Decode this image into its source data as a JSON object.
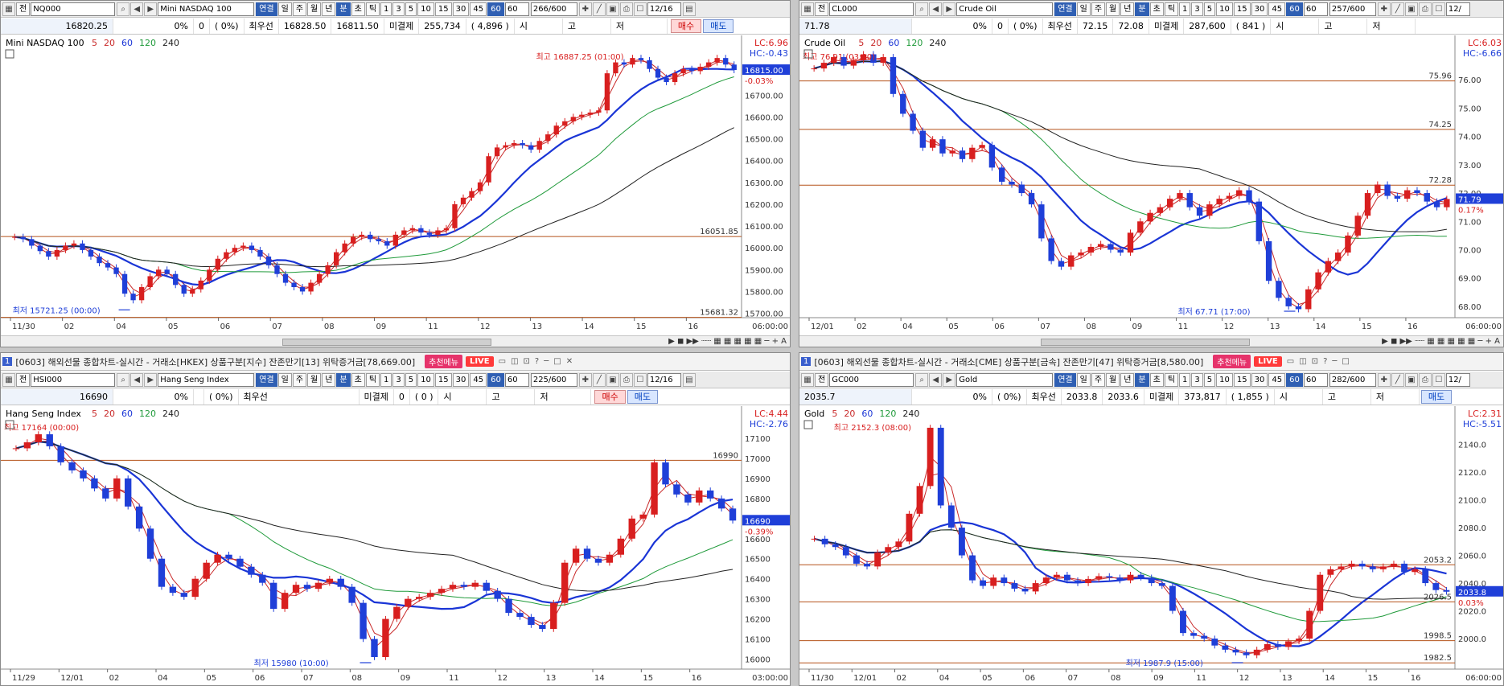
{
  "colors": {
    "up": "#d81f1f",
    "down": "#1f3fd8",
    "ma5": "#c92a2a",
    "ma20": "#c92a2a",
    "ma60": "#1a35d6",
    "ma120": "#1f9a3a",
    "ma240": "#222222",
    "hline": "#b5521a",
    "buy": "#c00000",
    "sell": "#0040c0"
  },
  "legend": {
    "ma_periods": [
      "5",
      "20",
      "60",
      "120",
      "240"
    ]
  },
  "periods": [
    "1",
    "3",
    "5",
    "10",
    "15",
    "30",
    "45",
    "60"
  ],
  "timeframes": [
    "연결",
    "일",
    "주",
    "월",
    "년",
    "분",
    "초",
    "틱"
  ],
  "panels": [
    {
      "id": "nq",
      "window_title": "",
      "code": "NQ000",
      "name": "Mini NASDAQ 100",
      "period": "60",
      "count": "266/600",
      "date": "12/16",
      "price": "16820.25",
      "change": "0",
      "pct": "0%",
      "pct_paren": "(      0%)",
      "best_label": "최우선",
      "best_bid": "16828.50",
      "best_ask": "16811.50",
      "oi_label": "미결제",
      "oi": "255,734",
      "oi_chg": "( 4,896 )",
      "o_label": "시",
      "h_label": "고",
      "l_label": "저",
      "buy": "매수",
      "sell": "매도",
      "chart_title": "Mini NASDAQ 100",
      "lc": "LC:6.96",
      "hc": "HC:-0.43",
      "cur_tag": "16815.00",
      "cur_pct": "-0.03%",
      "high_note": "최고 16887.25 (01:00)",
      "low_note": "최저 15721.25 (00:00)",
      "hlines": [
        {
          "v": 16051.85,
          "label": "16051.85"
        },
        {
          "v": 15681.32,
          "label": "15681.32"
        }
      ],
      "yticks": [
        "16700.00",
        "16600.00",
        "16500.00",
        "16400.00",
        "16300.00",
        "16200.00",
        "16100.00",
        "16000.00",
        "15900.00",
        "15800.00",
        "15700.00"
      ],
      "xticks": [
        "11/30",
        "02",
        "04",
        "05",
        "06",
        "07",
        "08",
        "09",
        "11",
        "12",
        "13",
        "14",
        "15",
        "16"
      ],
      "x_end": "06:00:00"
    },
    {
      "id": "cl",
      "window_title": "",
      "code": "CL000",
      "name": "Crude Oil",
      "period": "60",
      "count": "257/600",
      "date": "12/",
      "price": "71.78",
      "change": "0",
      "pct": "0%",
      "pct_paren": "(      0%)",
      "best_label": "최우선",
      "best_bid": "72.15",
      "best_ask": "72.08",
      "oi_label": "미결제",
      "oi": "287,600",
      "oi_chg": "(   841 )",
      "o_label": "시",
      "h_label": "고",
      "l_label": "저",
      "buy": "",
      "sell": "",
      "chart_title": "Crude Oil",
      "lc": "LC:6.03",
      "hc": "HC:-6.66",
      "cur_tag": "71.79",
      "cur_pct": "0.17%",
      "high_note": "최고 76.91 (03:00)",
      "low_note": "최저 67.71 (17:00)",
      "hlines": [
        {
          "v": 75.96,
          "label": "75.96"
        },
        {
          "v": 74.25,
          "label": "74.25"
        },
        {
          "v": 72.28,
          "label": "72.28"
        }
      ],
      "yticks": [
        "76.00",
        "75.00",
        "74.00",
        "73.00",
        "72.00",
        "71.00",
        "70.00",
        "69.00",
        "68.00"
      ],
      "xticks": [
        "12/01",
        "02",
        "04",
        "05",
        "06",
        "07",
        "08",
        "09",
        "11",
        "12",
        "13",
        "14",
        "15",
        "16"
      ],
      "x_end": "06:00:00"
    },
    {
      "id": "hsi",
      "window_title": "[0603] 해외선물 종합차트-실시간 - 거래소[HKEX] 상품구분[지수] 잔존만기[13] 위탁증거금[78,669.00]",
      "code": "HSI000",
      "name": "Hang Seng Index",
      "period": "60",
      "count": "225/600",
      "date": "12/16",
      "price": "16690",
      "change": "",
      "pct": "0%",
      "pct_paren": "(      0%)",
      "best_label": "최우선",
      "best_bid": "",
      "best_ask": "",
      "oi_label": "미결제",
      "oi": "0",
      "oi_chg": "(    0 )",
      "o_label": "시",
      "h_label": "고",
      "l_label": "저",
      "buy": "매수",
      "sell": "매도",
      "chart_title": "Hang Seng Index",
      "lc": "LC:4.44",
      "hc": "HC:-2.76",
      "cur_tag": "16690",
      "cur_pct": "-0.39%",
      "high_note": "최고 17164 (00:00)",
      "low_note": "최저 15980 (10:00)",
      "hlines": [
        {
          "v": 16990,
          "label": "16990"
        }
      ],
      "yticks": [
        "17100",
        "17000",
        "16900",
        "16800",
        "16700",
        "16600",
        "16500",
        "16400",
        "16300",
        "16200",
        "16100",
        "16000"
      ],
      "xticks": [
        "11/29",
        "12/01",
        "02",
        "04",
        "05",
        "06",
        "07",
        "08",
        "09",
        "11",
        "12",
        "13",
        "14",
        "15",
        "16"
      ],
      "x_end": "03:00:00"
    },
    {
      "id": "gc",
      "window_title": "[0603] 해외선물 종합차트-실시간 - 거래소[CME] 상품구분[금속] 잔존만기[47] 위탁증거금[8,580.00]",
      "code": "GC000",
      "name": "Gold",
      "period": "60",
      "count": "282/600",
      "date": "12/",
      "price": "2035.7",
      "change": "",
      "pct": "0%",
      "pct_paren": "(      0%)",
      "best_label": "최우선",
      "best_bid": "2033.8",
      "best_ask": "2033.6",
      "oi_label": "미결제",
      "oi": "373,817",
      "oi_chg": "( 1,855 )",
      "o_label": "시",
      "h_label": "고",
      "l_label": "저",
      "buy": "",
      "sell": "매도",
      "chart_title": "Gold",
      "lc": "LC:2.31",
      "hc": "HC:-5.51",
      "cur_tag": "2033.8",
      "cur_pct": "0.03%",
      "high_note": "최고 2152.3 (08:00)",
      "low_note": "최저 1987.9 (15:00)",
      "hlines": [
        {
          "v": 2053.2,
          "label": "2053.2"
        },
        {
          "v": 2026.5,
          "label": "2026.5"
        },
        {
          "v": 1998.5,
          "label": "1998.5"
        },
        {
          "v": 1982.5,
          "label": "1982.5"
        }
      ],
      "yticks": [
        "2140.0",
        "2120.0",
        "2100.0",
        "2080.0",
        "2060.0",
        "2040.0",
        "2020.0",
        "2000.0"
      ],
      "xticks": [
        "11/30",
        "12/01",
        "02",
        "04",
        "05",
        "06",
        "07",
        "08",
        "09",
        "11",
        "12",
        "13",
        "14",
        "15",
        "16"
      ],
      "x_end": "06:00:00"
    }
  ],
  "menu_label": "추천메뉴",
  "live_label": "LIVE",
  "chart_data": [
    {
      "type": "candlestick",
      "title": "Mini NASDAQ 100",
      "ylim": [
        15680,
        16900
      ],
      "close": [
        16050,
        16040,
        16010,
        15985,
        15960,
        15990,
        16010,
        16020,
        15990,
        15960,
        15930,
        15910,
        15880,
        15790,
        15760,
        15820,
        15870,
        15900,
        15880,
        15830,
        15790,
        15810,
        15850,
        15900,
        15950,
        15980,
        16000,
        16010,
        15990,
        15960,
        15920,
        15880,
        15840,
        15820,
        15800,
        15840,
        15880,
        15920,
        15980,
        16020,
        16050,
        16060,
        16040,
        16030,
        16010,
        16060,
        16080,
        16090,
        16070,
        16060,
        16080,
        16090,
        16200,
        16230,
        16260,
        16300,
        16420,
        16460,
        16470,
        16480,
        16470,
        16450,
        16490,
        16520,
        16560,
        16580,
        16600,
        16610,
        16620,
        16630,
        16800,
        16850,
        16840,
        16870,
        16860,
        16820,
        16780,
        16760,
        16800,
        16820,
        16810,
        16830,
        16850,
        16870,
        16840,
        16815
      ]
    },
    {
      "type": "candlestick",
      "title": "Crude Oil",
      "ylim": [
        67.6,
        77.0
      ],
      "close": [
        76.4,
        76.6,
        76.8,
        76.5,
        76.7,
        76.9,
        76.6,
        76.8,
        75.5,
        74.8,
        74.2,
        73.6,
        73.9,
        73.4,
        73.5,
        73.2,
        73.6,
        73.7,
        72.9,
        72.4,
        72.3,
        72.0,
        71.6,
        70.4,
        69.6,
        69.4,
        69.8,
        69.9,
        70.1,
        70.2,
        70.0,
        69.9,
        70.6,
        71.0,
        71.3,
        71.5,
        71.8,
        72.0,
        71.5,
        71.2,
        71.6,
        71.8,
        71.9,
        72.1,
        71.7,
        70.3,
        68.9,
        68.3,
        68.0,
        67.9,
        68.6,
        69.2,
        69.6,
        69.9,
        70.5,
        71.2,
        72.0,
        72.3,
        71.9,
        71.8,
        72.1,
        72.0,
        71.7,
        71.5,
        71.79
      ]
    },
    {
      "type": "candlestick",
      "title": "Hang Seng Index",
      "ylim": [
        15950,
        17180
      ],
      "close": [
        17050,
        17080,
        17120,
        17060,
        16980,
        16940,
        16900,
        16850,
        16800,
        16900,
        16760,
        16650,
        16500,
        16360,
        16330,
        16310,
        16400,
        16480,
        16520,
        16500,
        16460,
        16420,
        16380,
        16250,
        16330,
        16370,
        16350,
        16380,
        16400,
        16360,
        16280,
        16100,
        16010,
        16200,
        16260,
        16300,
        16310,
        16330,
        16350,
        16370,
        16360,
        16380,
        16340,
        16300,
        16230,
        16210,
        16170,
        16150,
        16280,
        16480,
        16550,
        16500,
        16480,
        16520,
        16600,
        16700,
        16720,
        16980,
        16870,
        16820,
        16780,
        16840,
        16800,
        16750,
        16690
      ]
    },
    {
      "type": "candlestick",
      "title": "Gold",
      "ylim": [
        1978,
        2156
      ],
      "close": [
        2072,
        2068,
        2066,
        2060,
        2054,
        2052,
        2062,
        2066,
        2070,
        2090,
        2110,
        2152,
        2096,
        2080,
        2060,
        2042,
        2038,
        2044,
        2040,
        2036,
        2034,
        2040,
        2044,
        2046,
        2042,
        2040,
        2043,
        2045,
        2044,
        2042,
        2046,
        2044,
        2040,
        2038,
        2020,
        2004,
        2002,
        2000,
        1995,
        1992,
        1990,
        1988,
        1992,
        1996,
        1994,
        1998,
        2000,
        2020,
        2046,
        2050,
        2052,
        2054,
        2052,
        2050,
        2052,
        2054,
        2048,
        2050,
        2040,
        2035,
        2033.8
      ]
    }
  ]
}
